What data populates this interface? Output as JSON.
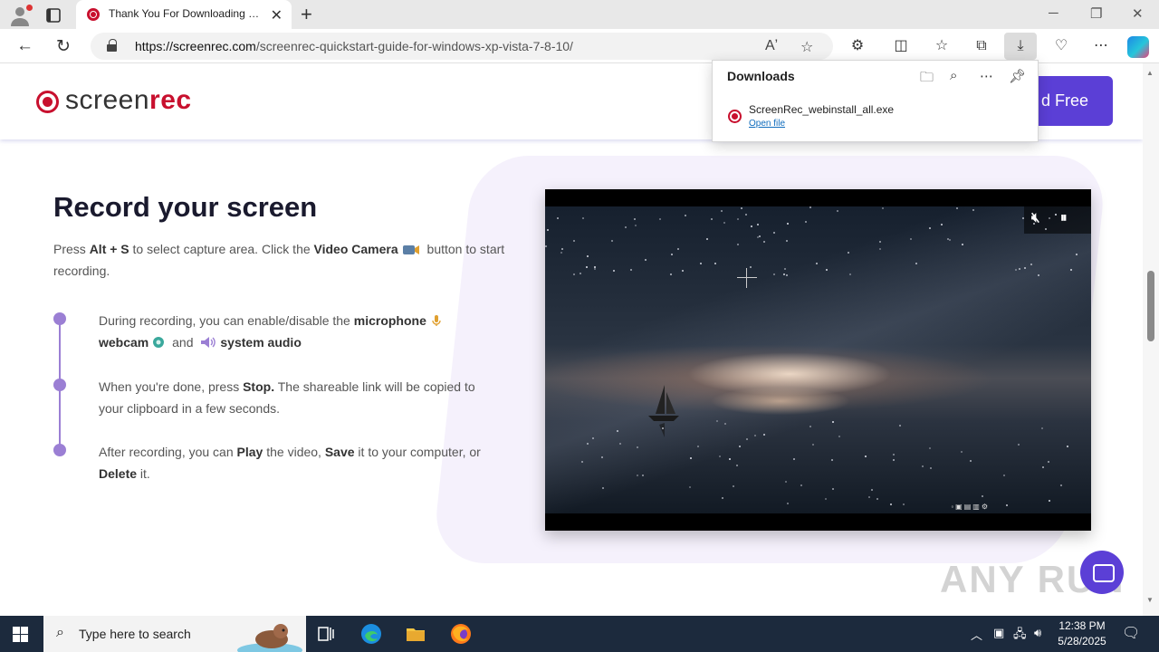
{
  "browser": {
    "tab": {
      "title": "Thank You For Downloading ScreenRec"
    },
    "address": {
      "host": "https://screenrec.com",
      "path": "/screenrec-quickstart-guide-for-windows-xp-vista-7-8-10/"
    }
  },
  "downloads": {
    "title": "Downloads",
    "file_name": "ScreenRec_webinstall_all.exe",
    "open_label": "Open file"
  },
  "site": {
    "logo": {
      "part1": "screen",
      "part2": "rec"
    },
    "download_button": "d Free"
  },
  "content": {
    "heading": "Record your screen",
    "intro": {
      "t1": "Press ",
      "key": "Alt + S",
      "t2": " to select capture area. Click the ",
      "cam": "Video Camera",
      "t3": " button to start recording."
    },
    "steps": [
      {
        "t1": "During recording, you can enable/disable the ",
        "b1": "microphone",
        "b2": "webcam",
        "t2": " and ",
        "b3": "system audio"
      },
      {
        "t1": "When you're done, press ",
        "b1": "Stop.",
        "t2": " The shareable link will be copied to your clipboard in a few seconds."
      },
      {
        "t1": "After recording, you can ",
        "b1": "Play",
        "t2": " the video, ",
        "b2": "Save",
        "t3": " it to your computer, or ",
        "b3": "Delete",
        "t4": " it."
      }
    ]
  },
  "watermark": "ANY RUN",
  "taskbar": {
    "search_placeholder": "Type here to search",
    "time": "12:38 PM",
    "date": "5/28/2025"
  },
  "colors": {
    "brand_red": "#c8102e",
    "brand_purple": "#5b3fd6",
    "timeline": "#9b7fd4"
  }
}
